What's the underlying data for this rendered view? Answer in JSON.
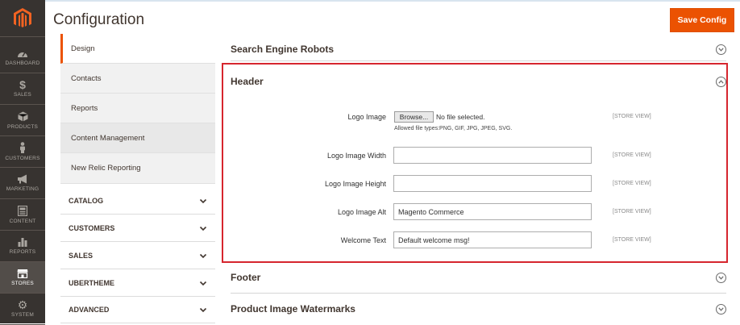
{
  "nav": {
    "items": [
      {
        "label": "DASHBOARD",
        "icon": "dashboard-icon"
      },
      {
        "label": "SALES",
        "icon": "dollar-icon"
      },
      {
        "label": "PRODUCTS",
        "icon": "cube-icon"
      },
      {
        "label": "CUSTOMERS",
        "icon": "person-icon"
      },
      {
        "label": "MARKETING",
        "icon": "megaphone-icon"
      },
      {
        "label": "CONTENT",
        "icon": "content-icon"
      },
      {
        "label": "REPORTS",
        "icon": "bar-chart-icon"
      },
      {
        "label": "STORES",
        "icon": "store-icon"
      },
      {
        "label": "SYSTEM",
        "icon": "gear-icon"
      }
    ]
  },
  "header": {
    "title": "Configuration",
    "save_label": "Save Config"
  },
  "tabs": {
    "sub_items": [
      "Design",
      "Contacts",
      "Reports",
      "Content Management",
      "New Relic Reporting"
    ],
    "sections": [
      "CATALOG",
      "CUSTOMERS",
      "SALES",
      "UBERTHEME",
      "ADVANCED"
    ]
  },
  "groups": {
    "robots": "Search Engine Robots",
    "header": "Header",
    "footer": "Footer",
    "watermarks": "Product Image Watermarks"
  },
  "fields": {
    "logo_image": {
      "label": "Logo Image",
      "browse": "Browse...",
      "no_file": "No file selected.",
      "note": "Allowed file types:PNG, GIF, JPG, JPEG, SVG.",
      "scope": "[STORE VIEW]"
    },
    "logo_width": {
      "label": "Logo Image Width",
      "value": "",
      "scope": "[STORE VIEW]"
    },
    "logo_height": {
      "label": "Logo Image Height",
      "value": "",
      "scope": "[STORE VIEW]"
    },
    "logo_alt": {
      "label": "Logo Image Alt",
      "value": "Magento Commerce",
      "scope": "[STORE VIEW]"
    },
    "welcome": {
      "label": "Welcome Text",
      "value": "Default welcome msg!",
      "scope": "[STORE VIEW]"
    }
  },
  "colors": {
    "accent": "#eb5202",
    "nav_bg": "#373330",
    "highlight": "#d6262e"
  }
}
